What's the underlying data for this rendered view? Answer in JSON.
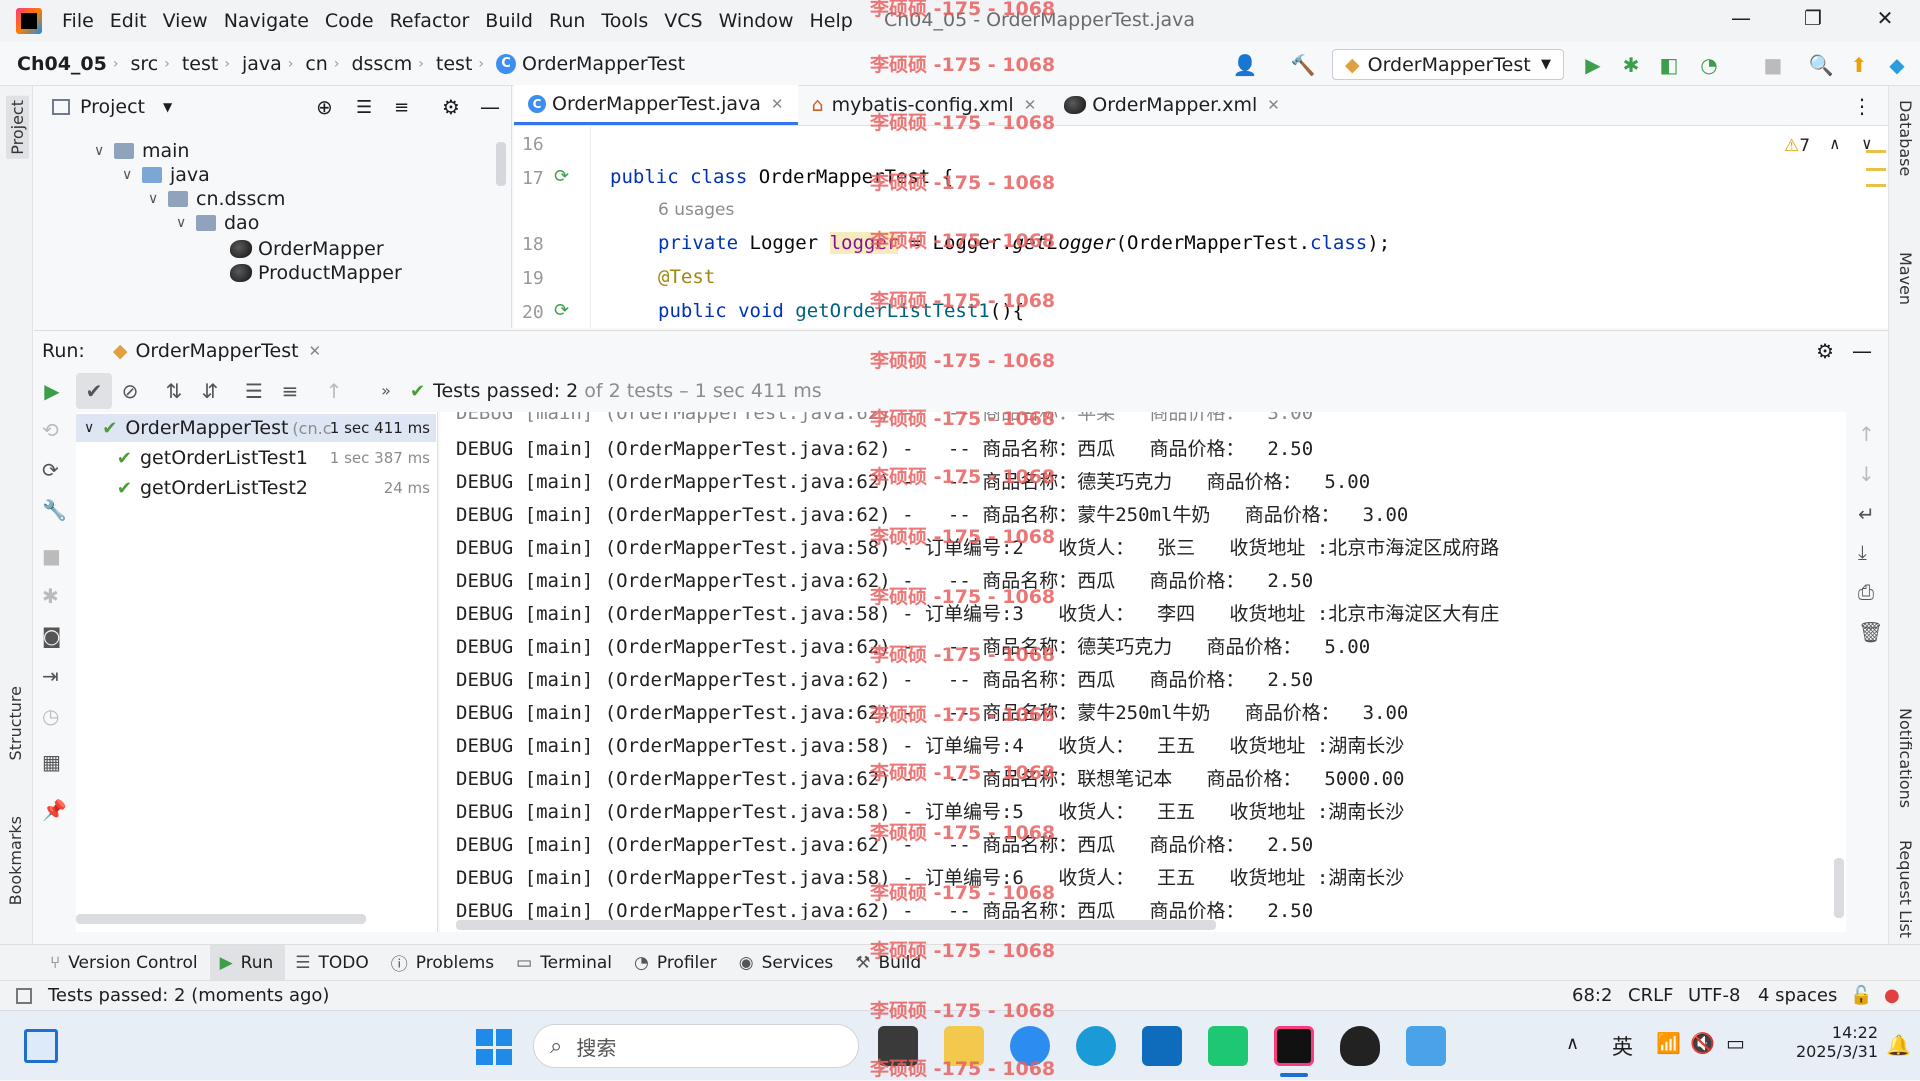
{
  "menu": [
    "File",
    "Edit",
    "View",
    "Navigate",
    "Code",
    "Refactor",
    "Build",
    "Run",
    "Tools",
    "VCS",
    "Window",
    "Help"
  ],
  "window_title": "Ch04_05 - OrderMapperTest.java",
  "breadcrumb": [
    "Ch04_05",
    "src",
    "test",
    "java",
    "cn",
    "dsscm",
    "test",
    "OrderMapperTest"
  ],
  "run_config": "OrderMapperTest",
  "project_panel": {
    "title": "Project",
    "items": [
      "main",
      "java",
      "cn.dsscm",
      "dao",
      "OrderMapper",
      "ProductMapper"
    ]
  },
  "editor_tabs": [
    "OrderMapperTest.java",
    "mybatis-config.xml",
    "OrderMapper.xml"
  ],
  "warnings_count": "7",
  "code": {
    "lines": [
      "16",
      "17",
      "18",
      "19",
      "20"
    ],
    "class_decl_kw": "public class ",
    "class_name": "OrderMapperTest {",
    "usages": "6 usages",
    "l18a": "private ",
    "l18b": "Logger ",
    "l18c": "logger",
    "l18d": " = Logger.",
    "l18e": "getLogger",
    "l18f": "(OrderMapperTest.",
    "l18g": "class",
    "l18h": ");",
    "l19": "@Test",
    "l20a": "public void ",
    "l20b": "getOrderListTest1",
    "l20c": "(){"
  },
  "run": {
    "label": "Run:",
    "tab": "OrderMapperTest",
    "status_prefix": "Tests passed: ",
    "status_count": "2",
    "status_rest": " of 2 tests – 1 sec 411 ms"
  },
  "tests": [
    {
      "name": "OrderMapperTest",
      "detail": "(cn.c",
      "duration": "1 sec 411 ms"
    },
    {
      "name": "getOrderListTest1",
      "duration": "1 sec 387 ms"
    },
    {
      "name": "getOrderListTest2",
      "duration": "24 ms"
    }
  ],
  "console_lines": [
    "DEBUG [main] (OrderMapperTest.java:62) -   -- 商品名称：西瓜   商品价格：  2.50",
    "DEBUG [main] (OrderMapperTest.java:62) -   -- 商品名称：德芙巧克力   商品价格：  5.00",
    "DEBUG [main] (OrderMapperTest.java:62) -   -- 商品名称：蒙牛250ml牛奶   商品价格：  3.00",
    "DEBUG [main] (OrderMapperTest.java:58) - 订单编号:2   收货人：  张三   收货地址 :北京市海淀区成府路",
    "DEBUG [main] (OrderMapperTest.java:62) -   -- 商品名称：西瓜   商品价格：  2.50",
    "DEBUG [main] (OrderMapperTest.java:58) - 订单编号:3   收货人：  李四   收货地址 :北京市海淀区大有庄",
    "DEBUG [main] (OrderMapperTest.java:62) -   -- 商品名称：德芙巧克力   商品价格：  5.00",
    "DEBUG [main] (OrderMapperTest.java:62) -   -- 商品名称：西瓜   商品价格：  2.50",
    "DEBUG [main] (OrderMapperTest.java:62) -   -- 商品名称：蒙牛250ml牛奶   商品价格：  3.00",
    "DEBUG [main] (OrderMapperTest.java:58) - 订单编号:4   收货人：  王五   收货地址 :湖南长沙",
    "DEBUG [main] (OrderMapperTest.java:62) -   -- 商品名称：联想笔记本   商品价格：  5000.00",
    "DEBUG [main] (OrderMapperTest.java:58) - 订单编号:5   收货人：  王五   收货地址 :湖南长沙",
    "DEBUG [main] (OrderMapperTest.java:62) -   -- 商品名称：西瓜   商品价格：  2.50",
    "DEBUG [main] (OrderMapperTest.java:58) - 订单编号:6   收货人：  王五   收货地址 :湖南长沙",
    "DEBUG [main] (OrderMapperTest.java:62) -   -- 商品名称：西瓜   商品价格：  2.50"
  ],
  "bottom_tabs": [
    "Version Control",
    "Run",
    "TODO",
    "Problems",
    "Terminal",
    "Profiler",
    "Services",
    "Build"
  ],
  "status": {
    "message": "Tests passed: 2 (moments ago)",
    "position": "68:2",
    "line_sep": "CRLF",
    "encoding": "UTF-8",
    "indent": "4 spaces"
  },
  "left_stripe": [
    "Project",
    "Structure",
    "Bookmarks"
  ],
  "right_stripe": [
    "Database",
    "Maven",
    "Notifications",
    "Request List"
  ],
  "taskbar": {
    "search_placeholder": "搜索",
    "ime": "英",
    "time": "14:22",
    "date": "2025/3/31"
  },
  "watermark": "李硕硕 -175 - 1068",
  "colors": {
    "accent": "#3574f0",
    "pass": "#4c9d3a",
    "keyword": "#0033b3",
    "watermark": "#e86060"
  }
}
